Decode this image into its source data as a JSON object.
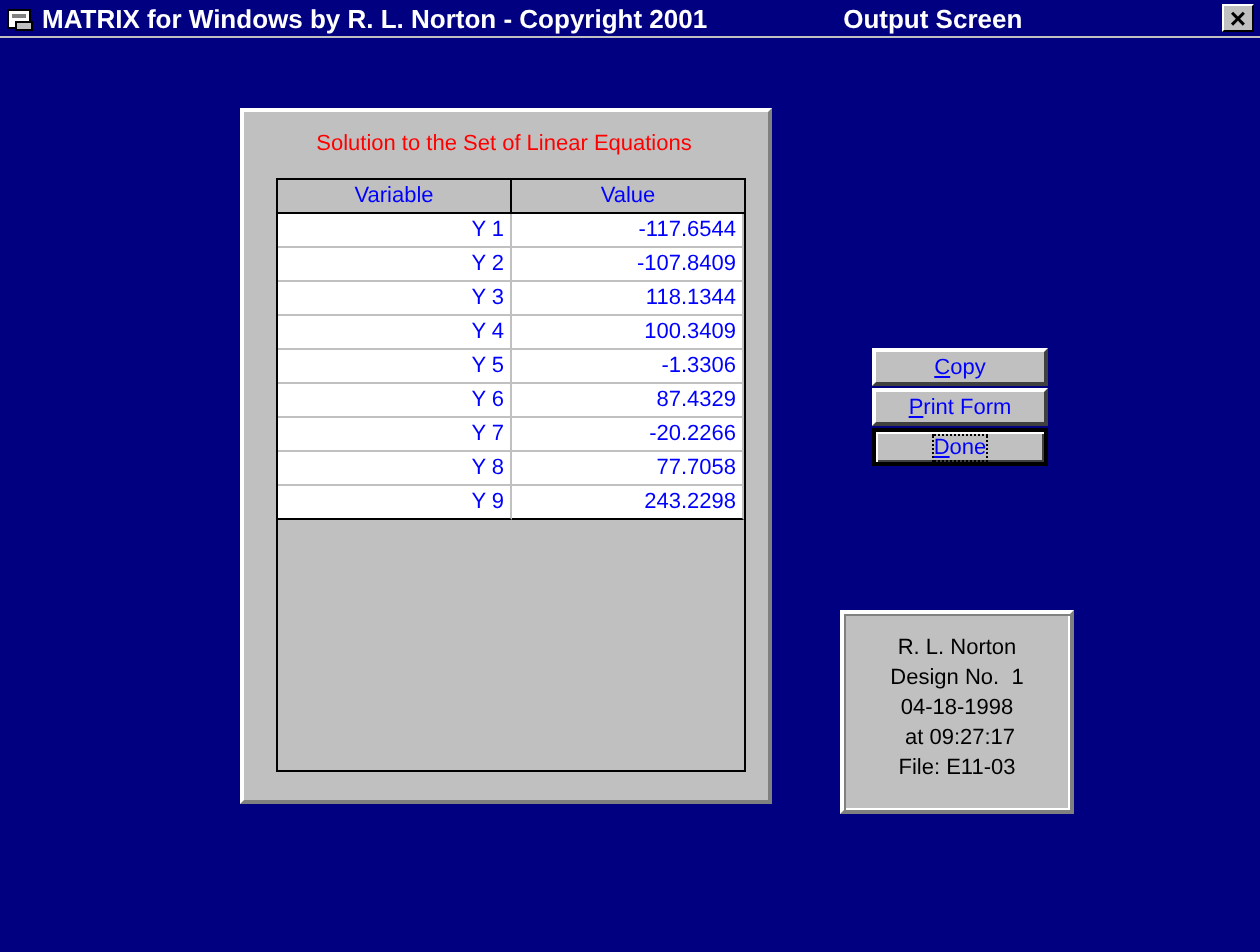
{
  "window": {
    "title": "MATRIX for Windows by R. L. Norton - Copyright 2001",
    "subtitle": "Output Screen",
    "close": "×"
  },
  "results": {
    "heading": "Solution to the Set of Linear Equations",
    "columns": [
      "Variable",
      "Value"
    ],
    "rows": [
      [
        "Y 1",
        "-117.6544"
      ],
      [
        "Y 2",
        "-107.8409"
      ],
      [
        "Y 3",
        "118.1344"
      ],
      [
        "Y 4",
        "100.3409"
      ],
      [
        "Y 5",
        "-1.3306"
      ],
      [
        "Y 6",
        "87.4329"
      ],
      [
        "Y 7",
        "-20.2266"
      ],
      [
        "Y 8",
        "77.7058"
      ],
      [
        "Y 9",
        "243.2298"
      ]
    ]
  },
  "buttons": [
    {
      "label": "Copy",
      "focused": false
    },
    {
      "label": "Print Form",
      "focused": false
    },
    {
      "label": "Done",
      "focused": true
    }
  ],
  "info": [
    "R. L. Norton",
    "Design No.  1",
    "04-18-1998",
    " at 09:27:17",
    "File: E11-03"
  ]
}
